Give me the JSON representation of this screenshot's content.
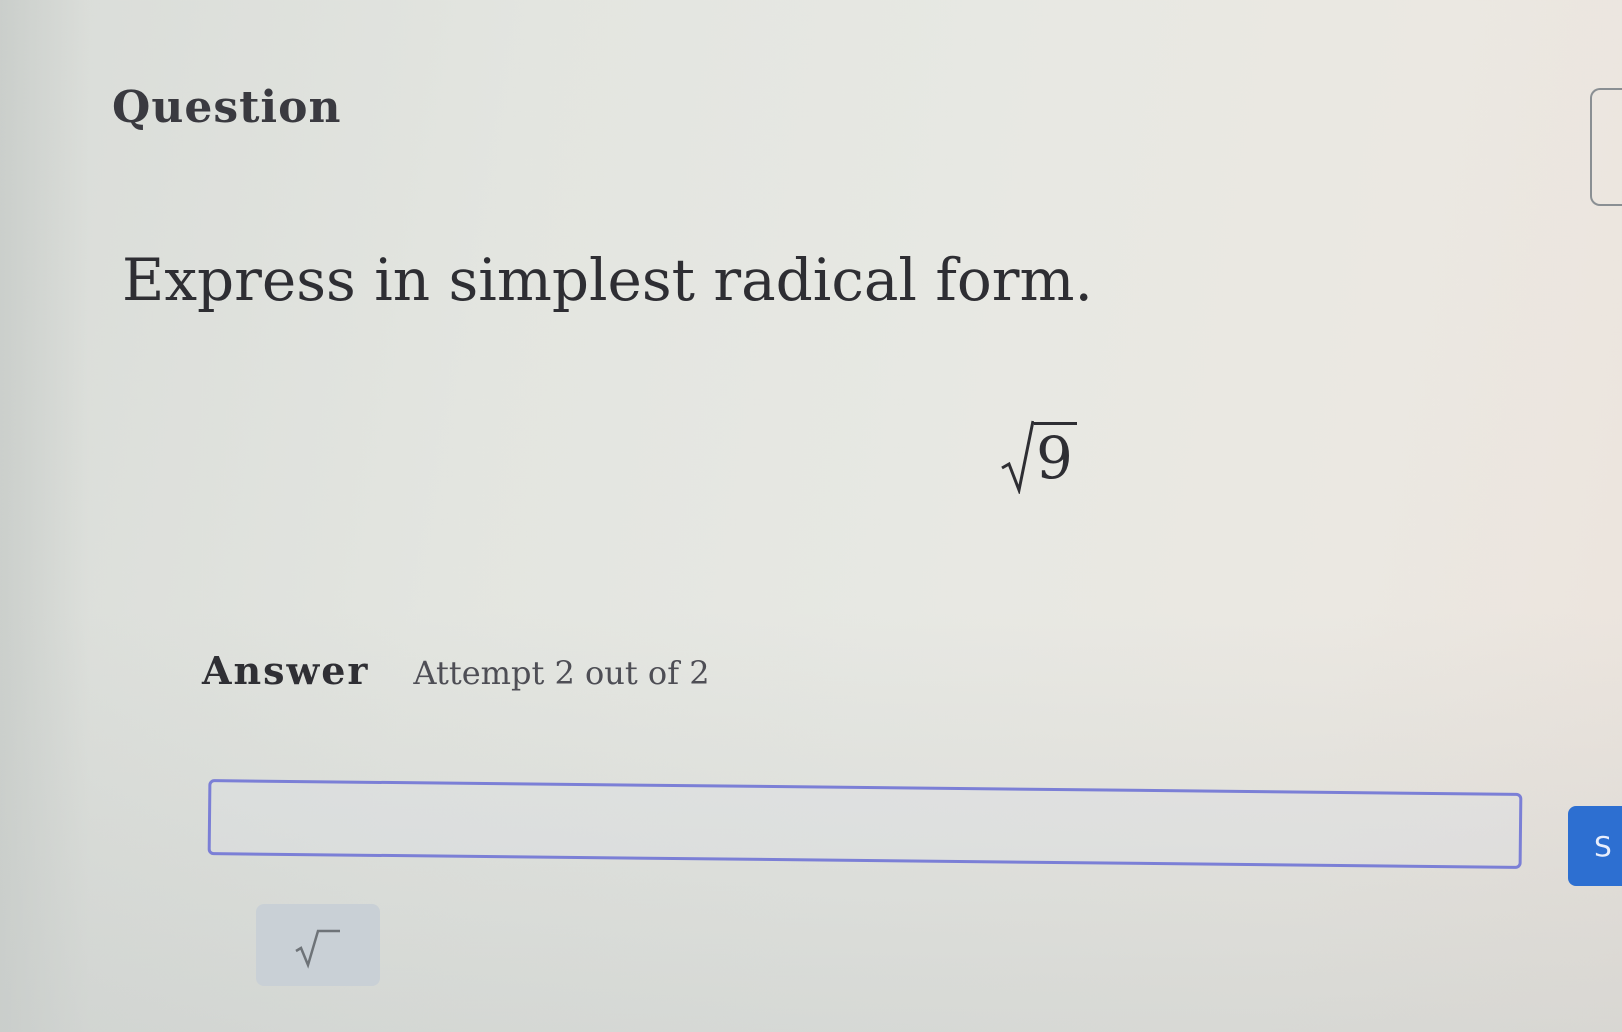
{
  "question": {
    "title": "Question",
    "prompt": "Express in simplest radical form.",
    "expression": {
      "radical": "√",
      "radicand": "9"
    }
  },
  "answer": {
    "label": "Answer",
    "attempt": "Attempt 2 out of 2",
    "input_value": "",
    "input_placeholder": ""
  },
  "toolbar": {
    "submit_label": "S",
    "sqrt_icon": "square-root-icon"
  },
  "colors": {
    "input_border": "#7b7fd6",
    "submit_button": "#2d6fd1",
    "sqrt_button_bg": "#c9d0d6"
  }
}
